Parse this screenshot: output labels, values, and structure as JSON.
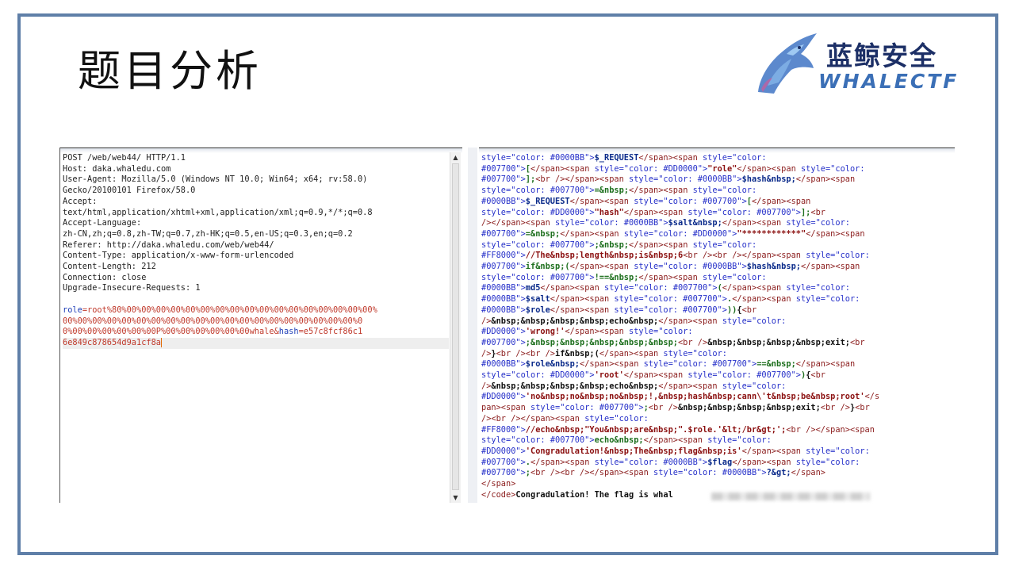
{
  "slide": {
    "title": "题目分析",
    "logo_cn": "蓝鲸安全",
    "logo_en": "WHALECTF"
  },
  "request": {
    "headers": [
      "POST /web/web44/ HTTP/1.1",
      "Host: daka.whaledu.com",
      "User-Agent: Mozilla/5.0 (Windows NT 10.0; Win64; x64; rv:58.0)",
      "Gecko/20100101 Firefox/58.0",
      "Accept:",
      "text/html,application/xhtml+xml,application/xml;q=0.9,*/*;q=0.8",
      "Accept-Language:",
      "zh-CN,zh;q=0.8,zh-TW;q=0.7,zh-HK;q=0.5,en-US;q=0.3,en;q=0.2",
      "Referer: http://daka.whaledu.com/web/web44/",
      "Content-Type: application/x-www-form-urlencoded",
      "Content-Length: 212",
      "Connection: close",
      "Upgrade-Insecure-Requests: 1"
    ],
    "body_key1": "role",
    "body_eq1": "=",
    "body_line1": "root%80%00%00%00%00%00%00%00%00%00%00%00%00%00%00%00%00%00%",
    "body_line2": "00%00%00%00%00%00%00%00%00%00%00%00%00%00%00%00%00%00%00%00%0",
    "body_line3a": "0%00%00%00%00%00%00P%00%00%00%00%00%00whale",
    "body_amp": "&",
    "body_key2": "hash",
    "body_eq2": "=",
    "body_line3b": "e57c8fcf86c1",
    "body_line4": "6e849c878654d9a1cf8a"
  },
  "response": {
    "lines": [
      [
        [
          "s",
          "style=\"color: #0000BB\">"
        ],
        [
          "b",
          "$_REQUEST"
        ],
        [
          "t",
          "</span><span "
        ],
        [
          "s",
          "style=\"color:"
        ]
      ],
      [
        [
          "s",
          "#007700\">"
        ],
        [
          "b",
          "["
        ],
        [
          "t",
          "</span><span "
        ],
        [
          "s",
          "style=\"color: #DD0000\">"
        ],
        [
          "b",
          "\"role\""
        ],
        [
          "t",
          "</span><span "
        ],
        [
          "s",
          "style=\"color:"
        ]
      ],
      [
        [
          "s",
          "#007700\">"
        ],
        [
          "b",
          "];"
        ],
        [
          "t",
          "<br />"
        ],
        [
          "t",
          "</span><span "
        ],
        [
          "s",
          "style=\"color: #0000BB\">"
        ],
        [
          "b",
          "$hash&nbsp;"
        ],
        [
          "t",
          "</span><span"
        ]
      ],
      [
        [
          "s",
          "style=\"color: #007700\">"
        ],
        [
          "b",
          "=&nbsp;"
        ],
        [
          "t",
          "</span><span "
        ],
        [
          "s",
          "style=\"color:"
        ]
      ],
      [
        [
          "s",
          "#0000BB\">"
        ],
        [
          "b",
          "$_REQUEST"
        ],
        [
          "t",
          "</span><span "
        ],
        [
          "s",
          "style=\"color: #007700\">"
        ],
        [
          "b",
          "["
        ],
        [
          "t",
          "</span><span"
        ]
      ],
      [
        [
          "s",
          "style=\"color: #DD0000\">"
        ],
        [
          "b",
          "\"hash\""
        ],
        [
          "t",
          "</span><span "
        ],
        [
          "s",
          "style=\"color: #007700\">"
        ],
        [
          "b",
          "];"
        ],
        [
          "t",
          "<br"
        ]
      ],
      [
        [
          "t",
          "/></span><span "
        ],
        [
          "s",
          "style=\"color: #0000BB\">"
        ],
        [
          "b",
          "$salt&nbsp;"
        ],
        [
          "t",
          "</span><span "
        ],
        [
          "s",
          "style=\"color:"
        ]
      ],
      [
        [
          "s",
          "#007700\">"
        ],
        [
          "b",
          "=&nbsp;"
        ],
        [
          "t",
          "</span><span "
        ],
        [
          "s",
          "style=\"color: #DD0000\">"
        ],
        [
          "b",
          "\"************\""
        ],
        [
          "t",
          "</span><span"
        ]
      ],
      [
        [
          "s",
          "style=\"color: #007700\">"
        ],
        [
          "b",
          ";&nbsp;"
        ],
        [
          "t",
          "</span><span "
        ],
        [
          "s",
          "style=\"color:"
        ]
      ],
      [
        [
          "s",
          "#FF8000\">"
        ],
        [
          "b",
          "//The&nbsp;length&nbsp;is&nbsp;6"
        ],
        [
          "t",
          "<br />"
        ],
        [
          "t",
          "<br />"
        ],
        [
          "t",
          "</span><span "
        ],
        [
          "s",
          "style=\"color:"
        ]
      ],
      [
        [
          "s",
          "#007700\">"
        ],
        [
          "b",
          "if&nbsp;("
        ],
        [
          "t",
          "</span><span "
        ],
        [
          "s",
          "style=\"color: #0000BB\">"
        ],
        [
          "b",
          "$hash&nbsp;"
        ],
        [
          "t",
          "</span><span"
        ]
      ],
      [
        [
          "s",
          "style=\"color: #007700\">"
        ],
        [
          "b",
          "!==&nbsp;"
        ],
        [
          "t",
          "</span><span "
        ],
        [
          "s",
          "style=\"color:"
        ]
      ],
      [
        [
          "s",
          "#0000BB\">"
        ],
        [
          "b",
          "md5"
        ],
        [
          "t",
          "</span><span "
        ],
        [
          "s",
          "style=\"color: #007700\">"
        ],
        [
          "b",
          "("
        ],
        [
          "t",
          "</span><span "
        ],
        [
          "s",
          "style=\"color:"
        ]
      ],
      [
        [
          "s",
          "#0000BB\">"
        ],
        [
          "b",
          "$salt"
        ],
        [
          "t",
          "</span><span "
        ],
        [
          "s",
          "style=\"color: #007700\">"
        ],
        [
          "b",
          "."
        ],
        [
          "t",
          "</span><span "
        ],
        [
          "s",
          "style=\"color:"
        ]
      ],
      [
        [
          "s",
          "#0000BB\">"
        ],
        [
          "b",
          "$role"
        ],
        [
          "t",
          "</span><span "
        ],
        [
          "s",
          "style=\"color: #007700\">"
        ],
        [
          "b",
          "))"
        ],
        [
          "b",
          "{"
        ],
        [
          "t",
          "<br"
        ]
      ],
      [
        [
          "t",
          "/>"
        ],
        [
          "b",
          "&nbsp;&nbsp;&nbsp;&nbsp;echo&nbsp;"
        ],
        [
          "t",
          "</span><span "
        ],
        [
          "s",
          "style=\"color:"
        ]
      ],
      [
        [
          "s",
          "#DD0000\">"
        ],
        [
          "b",
          "'wrong!'"
        ],
        [
          "t",
          "</span><span "
        ],
        [
          "s",
          "style=\"color:"
        ]
      ],
      [
        [
          "s",
          "#007700\">"
        ],
        [
          "b",
          ";&nbsp;&nbsp;&nbsp;&nbsp;&nbsp;"
        ],
        [
          "t",
          "<br />"
        ],
        [
          "b",
          "&nbsp;&nbsp;&nbsp;&nbsp;exit;"
        ],
        [
          "t",
          "<br"
        ]
      ],
      [
        [
          "t",
          "/>"
        ],
        [
          "b",
          "}"
        ],
        [
          "t",
          "<br />"
        ],
        [
          "t",
          "<br />"
        ],
        [
          "b",
          "if&nbsp;("
        ],
        [
          "t",
          "</span><span "
        ],
        [
          "s",
          "style=\"color:"
        ]
      ],
      [
        [
          "s",
          "#0000BB\">"
        ],
        [
          "b",
          "$role&nbsp;"
        ],
        [
          "t",
          "</span><span "
        ],
        [
          "s",
          "style=\"color: #007700\">"
        ],
        [
          "b",
          "==&nbsp;"
        ],
        [
          "t",
          "</span><span"
        ]
      ],
      [
        [
          "s",
          "style=\"color: #DD0000\">"
        ],
        [
          "b",
          "'root'"
        ],
        [
          "t",
          "</span><span "
        ],
        [
          "s",
          "style=\"color: #007700\">"
        ],
        [
          "b",
          ")"
        ],
        [
          "b",
          "{"
        ],
        [
          "t",
          "<br"
        ]
      ],
      [
        [
          "t",
          "/>"
        ],
        [
          "b",
          "&nbsp;&nbsp;&nbsp;&nbsp;echo&nbsp;"
        ],
        [
          "t",
          "</span><span "
        ],
        [
          "s",
          "style=\"color:"
        ]
      ],
      [
        [
          "s",
          "#DD0000\">"
        ],
        [
          "b",
          "'no&nbsp;no&nbsp;no&nbsp;!,&nbsp;hash&nbsp;cann\\'t&nbsp;be&nbsp;root'"
        ],
        [
          "t",
          "</s"
        ]
      ],
      [
        [
          "t",
          "pan><span "
        ],
        [
          "s",
          "style=\"color: #007700\">"
        ],
        [
          "b",
          ";"
        ],
        [
          "t",
          "<br />"
        ],
        [
          "b",
          "&nbsp;&nbsp;&nbsp;&nbsp;exit;"
        ],
        [
          "t",
          "<br />"
        ],
        [
          "b",
          "}"
        ],
        [
          "t",
          "<br"
        ]
      ],
      [
        [
          "t",
          "/>"
        ],
        [
          "t",
          "<br />"
        ],
        [
          "t",
          "</span><span "
        ],
        [
          "s",
          "style=\"color:"
        ]
      ],
      [
        [
          "s",
          "#FF8000\">"
        ],
        [
          "b",
          "//echo&nbsp;\"You&nbsp;are&nbsp;\".$role.'&lt;/br&gt;';"
        ],
        [
          "t",
          "<br />"
        ],
        [
          "t",
          "</span><span"
        ]
      ],
      [
        [
          "s",
          "style=\"color: #007700\">"
        ],
        [
          "b",
          "echo&nbsp;"
        ],
        [
          "t",
          "</span><span "
        ],
        [
          "s",
          "style=\"color:"
        ]
      ],
      [
        [
          "s",
          "#DD0000\">"
        ],
        [
          "b",
          "'Congradulation!&nbsp;The&nbsp;flag&nbsp;is'"
        ],
        [
          "t",
          "</span><span "
        ],
        [
          "s",
          "style=\"color:"
        ]
      ],
      [
        [
          "s",
          "#007700\">"
        ],
        [
          "b",
          "."
        ],
        [
          "t",
          "</span><span "
        ],
        [
          "s",
          "style=\"color: #0000BB\">"
        ],
        [
          "b",
          "$flag"
        ],
        [
          "t",
          "</span><span "
        ],
        [
          "s",
          "style=\"color:"
        ]
      ],
      [
        [
          "s",
          "#007700\">"
        ],
        [
          "b",
          ";"
        ],
        [
          "t",
          "<br />"
        ],
        [
          "t",
          "<br />"
        ],
        [
          "t",
          "</span><span "
        ],
        [
          "s",
          "style=\"color: #0000BB\">"
        ],
        [
          "b",
          "?&gt;"
        ],
        [
          "t",
          "</span>"
        ]
      ],
      [
        [
          "t",
          "</span>"
        ]
      ],
      [
        [
          "t",
          "</code>"
        ],
        [
          "b",
          "Congradulation! The flag is whal"
        ]
      ]
    ]
  }
}
